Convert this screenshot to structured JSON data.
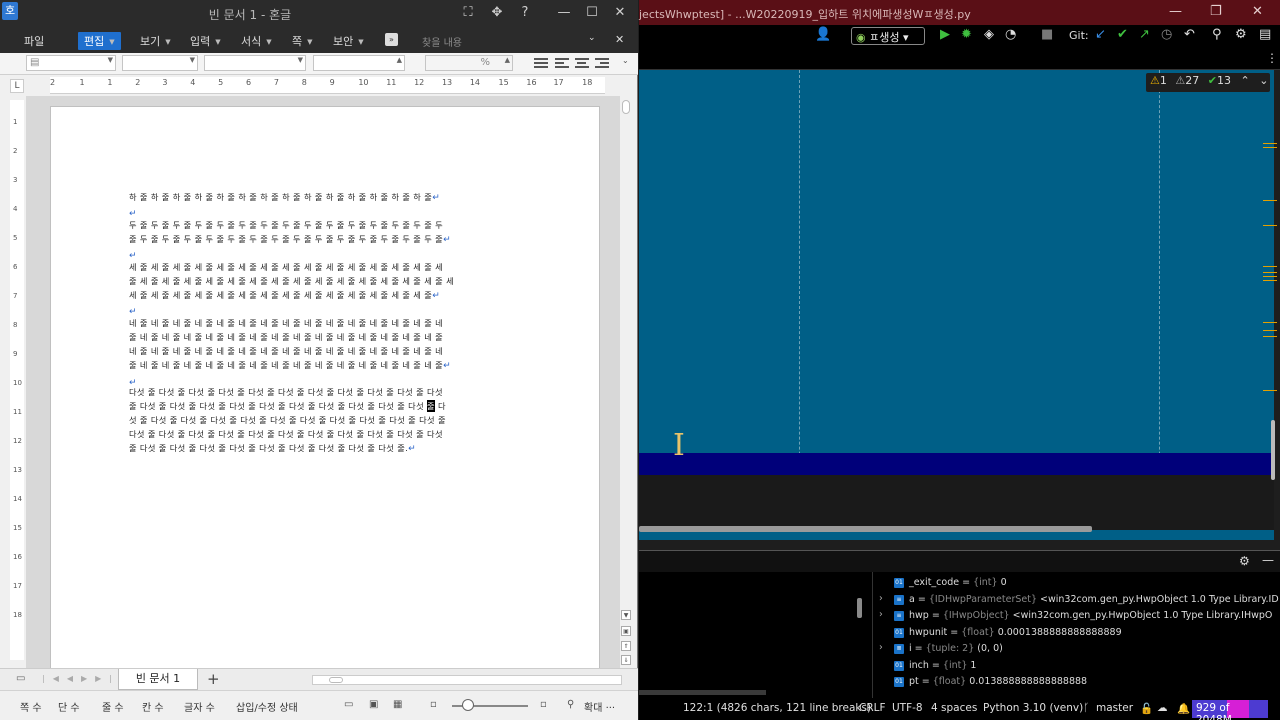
{
  "hwp": {
    "logo": "호",
    "title": "빈 문서 1 - 혼글",
    "window_buttons": [
      "⛶",
      "✥",
      "?",
      "—",
      "☐",
      "✕"
    ],
    "menu": [
      {
        "label": "파일",
        "caret": false
      },
      {
        "label": "편집",
        "caret": true
      },
      {
        "label": "보기",
        "caret": true
      },
      {
        "label": "입력",
        "caret": true
      },
      {
        "label": "서식",
        "caret": true
      },
      {
        "label": "쪽",
        "caret": true
      },
      {
        "label": "보안",
        "caret": true
      }
    ],
    "find_placeholder": "찾을 내용",
    "toolbar": {
      "percent": "%"
    },
    "ruler_numbers": [
      "2",
      "1",
      "1",
      "2",
      "3",
      "4",
      "5",
      "6",
      "7",
      "8",
      "9",
      "10",
      "11",
      "12",
      "13",
      "14",
      "15",
      "16",
      "17",
      "18"
    ],
    "vruler_numbers": [
      "1",
      "2",
      "3",
      "4",
      "5",
      "6",
      "7",
      "8",
      "9",
      "10",
      "11",
      "12",
      "13",
      "14",
      "15",
      "16",
      "17",
      "18"
    ],
    "document_lines": [
      {
        "text": "하 줄 하 줄 하 줄 하 줄 하 줄 하 줄 하 줄 하 줄 하 줄 하 줄 하 줄 하 줄 하 줄 하 줄",
        "ret": true
      },
      {
        "text": "",
        "ret": true
      },
      {
        "text": "두 줄 두 줄 두 줄 두 줄 두 줄 두 줄 두 줄 두 줄 두 줄 두 줄 두 줄 두 줄 두 줄 두 줄 두",
        "ret": false
      },
      {
        "text": "줄 두 줄 두 줄 두 줄 두 줄 두 줄 두 줄 두 줄 두 줄 두 줄 두 줄 두 줄 두 줄 두 줄 두 줄",
        "ret": true
      },
      {
        "text": "",
        "ret": true
      },
      {
        "text": "세 줄 세 줄 세 줄 세 줄 세 줄 세 줄 세 줄 세 줄 세 줄 세 줄 세 줄 세 줄 세 줄 세 줄 세",
        "ret": false
      },
      {
        "text": "줄 세 줄 세 줄 세 줄 세 줄 세 줄 세 줄 세 줄 세 줄 세 줄 세 줄 세 줄 세 줄 세 줄 세 줄 세",
        "ret": false
      },
      {
        "text": "세 줄 세 줄 세 줄 세 줄 세 줄 세 줄 세 줄 세 줄 세 줄 세 줄 세 줄 세 줄 세 줄 세 줄",
        "ret": true
      },
      {
        "text": "",
        "ret": true
      },
      {
        "text": "네 줄 네 줄 네 줄 네 줄 네 줄 네 줄 네 줄 네 줄 네 줄 네 줄 네 줄 네 줄 네 줄 네 줄 네",
        "ret": false
      },
      {
        "text": "줄 네 줄 네 줄 네 줄 네 줄 네 줄 네 줄 네 줄 네 줄 네 줄 네 줄 네 줄 네 줄 네 줄 네 줄",
        "ret": false
      },
      {
        "text": "네 줄 네 줄 네 줄 네 줄 네 줄 네 줄 네 줄 네 줄 네 줄 네 줄 네 줄 네 줄 네 줄 네 줄 네",
        "ret": false
      },
      {
        "text": "줄 네 줄 네 줄 네 줄 네 줄 네 줄 네 줄 네 줄 네 줄 네 줄 네 줄 네 줄 네 줄 네 줄 네 줄",
        "ret": true
      },
      {
        "text": "",
        "ret": true
      },
      {
        "text": "다섯 줄 다섯 줄 다섯 줄 다섯 줄 다섯 줄 다섯 줄 다섯 줄 다섯 줄 다섯 줄 다섯 줄 다섯",
        "ret": false
      },
      {
        "text": "줄 다섯 줄 다섯 줄 다섯 줄 다섯 줄 다섯 줄 다섯 줄 다섯 줄 다섯 줄 다섯 줄 다섯 ",
        "cursor": "줄",
        "after": " 다",
        "ret": false
      },
      {
        "text": "섯 줄 다섯 줄 다섯 줄 다섯 줄 다섯 줄 다섯 줄 다섯 줄 다섯 줄 다섯 줄 다섯 줄 다섯 줄",
        "ret": false
      },
      {
        "text": "다섯 줄 다섯 줄 다섯 줄 다섯 줄 다섯 줄 다섯 줄 다섯 줄 다섯 줄 다섯 줄 다섯 줄 다섯",
        "ret": false
      },
      {
        "text": "줄 다섯 줄 다섯 줄 다섯 줄 다섯 줄 다섯 줄 다섯 줄 다섯 줄 다섯 줄 다섯 줄.",
        "ret": true
      }
    ],
    "tab_label": "빈 문서 1",
    "tab_add": "+",
    "status": {
      "page": "쪽 수",
      "section": "단 수",
      "line": "줄 수",
      "column": "칸 수",
      "chars": "글자 수",
      "mode": "삽입/수정 상태",
      "zoom_label": "확대 ···"
    }
  },
  "ide": {
    "title": "jectsWhwptest] - ...W20220919_입하트 위치에파생성Wㅍ생성.py",
    "window_buttons": [
      "—",
      "❐",
      "✕"
    ],
    "run_config": "ㅍ생성",
    "git_label": "Git:",
    "inspections": {
      "warnings": "1",
      "weak_warnings": "27",
      "ok": "13"
    },
    "variables": [
      {
        "expand": false,
        "icon": "01",
        "name": "_exit_code",
        "type": "{int}",
        "value": "0"
      },
      {
        "expand": true,
        "icon": "≡",
        "name": "a",
        "type": "{IDHwpParameterSet}",
        "value": "<win32com.gen_py.HwpObject 1.0 Type Library.ID"
      },
      {
        "expand": true,
        "icon": "≡",
        "name": "hwp",
        "type": "{IHwpObject}",
        "value": "<win32com.gen_py.HwpObject 1.0 Type Library.IHwpO"
      },
      {
        "expand": false,
        "icon": "01",
        "name": "hwpunit",
        "type": "{float}",
        "value": "0.0001388888888888889"
      },
      {
        "expand": true,
        "icon": "≣",
        "name": "i",
        "type": "{tuple: 2}",
        "value": "(0, 0)"
      },
      {
        "expand": false,
        "icon": "01",
        "name": "inch",
        "type": "{int}",
        "value": "1"
      },
      {
        "expand": false,
        "icon": "01",
        "name": "pt",
        "type": "{float}",
        "value": "0.013888888888888888"
      }
    ],
    "status": {
      "position": "122:1 (4826 chars, 121 line breaks)",
      "line_sep": "CRLF",
      "encoding": "UTF-8",
      "indent": "4 spaces",
      "interpreter": "Python 3.10 (venv)",
      "branch": "master",
      "memory": "929 of 2048M"
    }
  }
}
